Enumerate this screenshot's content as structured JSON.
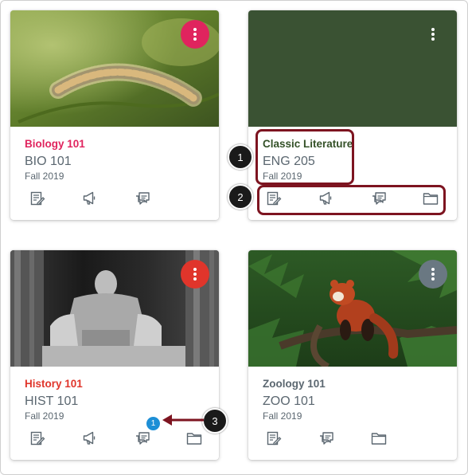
{
  "colors": {
    "biology_accent": "#e0245e",
    "literature_accent": "#345128",
    "literature_hero": "#3a5233",
    "history_accent": "#e0352b",
    "zoology_accent": "#5b6770",
    "callout_outline": "#7d1420",
    "unread_badge": "#1d8fd6"
  },
  "cards": [
    {
      "title": "Biology 101",
      "code": "BIO 101",
      "term": "Fall 2019",
      "hero": "caterpillar-photo",
      "actions": [
        "assignments-icon",
        "announcements-icon",
        "discussions-icon"
      ]
    },
    {
      "title": "Classic Literature",
      "code": "ENG 205",
      "term": "Fall 2019",
      "hero": "solid-color",
      "actions": [
        "assignments-icon",
        "announcements-icon",
        "discussions-icon",
        "files-icon"
      ]
    },
    {
      "title": "History 101",
      "code": "HIST 101",
      "term": "Fall 2019",
      "hero": "lincoln-memorial-photo",
      "unread_count": "1",
      "actions": [
        "assignments-icon",
        "announcements-icon",
        "discussions-icon",
        "files-icon"
      ]
    },
    {
      "title": "Zoology 101",
      "code": "ZOO 101",
      "term": "Fall 2019",
      "hero": "red-panda-photo",
      "actions": [
        "assignments-icon",
        "discussions-icon",
        "files-icon"
      ]
    }
  ],
  "callouts": [
    "1",
    "2",
    "3"
  ]
}
